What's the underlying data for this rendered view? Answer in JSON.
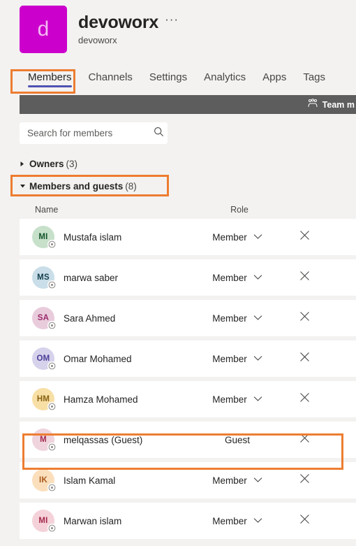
{
  "team": {
    "logo_initial": "d",
    "logo_color": "#CC00CC",
    "name": "devoworx",
    "subtitle": "devoworx",
    "more_options": "···"
  },
  "tabs": [
    {
      "label": "Members",
      "active": true
    },
    {
      "label": "Channels",
      "active": false
    },
    {
      "label": "Settings",
      "active": false
    },
    {
      "label": "Analytics",
      "active": false
    },
    {
      "label": "Apps",
      "active": false
    },
    {
      "label": "Tags",
      "active": false
    }
  ],
  "command_bar": {
    "background": "#5D5D5D",
    "item_label": "Team m",
    "item_icon": "people-icon"
  },
  "search": {
    "placeholder": "Search for members",
    "value": "",
    "icon": "search-icon"
  },
  "groups": [
    {
      "label": "Owners",
      "count": "(3)",
      "expanded": false
    },
    {
      "label": "Members and guests",
      "count": "(8)",
      "expanded": true
    }
  ],
  "table": {
    "columns": {
      "name": "Name",
      "role": "Role"
    },
    "rows": [
      {
        "initials": "MI",
        "name": "Mustafa islam",
        "role": "Member",
        "has_dropdown": true,
        "avatar_bg": "#C7E0CA",
        "avatar_fg": "#13532B",
        "remove_icon": "close-icon",
        "highlighted": false
      },
      {
        "initials": "MS",
        "name": "marwa saber",
        "role": "Member",
        "has_dropdown": true,
        "avatar_bg": "#C9DEE8",
        "avatar_fg": "#15404F",
        "remove_icon": "close-icon",
        "highlighted": false
      },
      {
        "initials": "SA",
        "name": "Sara Ahmed",
        "role": "Member",
        "has_dropdown": true,
        "avatar_bg": "#E9CCDC",
        "avatar_fg": "#9B2B6B",
        "remove_icon": "close-icon",
        "highlighted": false
      },
      {
        "initials": "OM",
        "name": "Omar Mohamed",
        "role": "Member",
        "has_dropdown": true,
        "avatar_bg": "#D6D2EC",
        "avatar_fg": "#4A3E96",
        "remove_icon": "close-icon",
        "highlighted": false
      },
      {
        "initials": "HM",
        "name": "Hamza Mohamed",
        "role": "Member",
        "has_dropdown": true,
        "avatar_bg": "#F7DFA5",
        "avatar_fg": "#8A6112",
        "remove_icon": "close-icon",
        "highlighted": false
      },
      {
        "initials": "M",
        "name": "melqassas (Guest)",
        "role": "Guest",
        "has_dropdown": false,
        "avatar_bg": "#EFD4DD",
        "avatar_fg": "#A42A4E",
        "remove_icon": "close-icon",
        "highlighted": true
      },
      {
        "initials": "IK",
        "name": "Islam Kamal",
        "role": "Member",
        "has_dropdown": true,
        "avatar_bg": "#FBDFBC",
        "avatar_fg": "#A8581B",
        "remove_icon": "close-icon",
        "highlighted": false
      },
      {
        "initials": "MI",
        "name": "Marwan islam",
        "role": "Member",
        "has_dropdown": true,
        "avatar_bg": "#F5D2D9",
        "avatar_fg": "#A3294A",
        "remove_icon": "close-icon",
        "highlighted": false
      }
    ]
  },
  "annotations": {
    "color": "#ED7D31",
    "targets": [
      "members-tab",
      "members-and-guests-group",
      "guest-row"
    ]
  }
}
